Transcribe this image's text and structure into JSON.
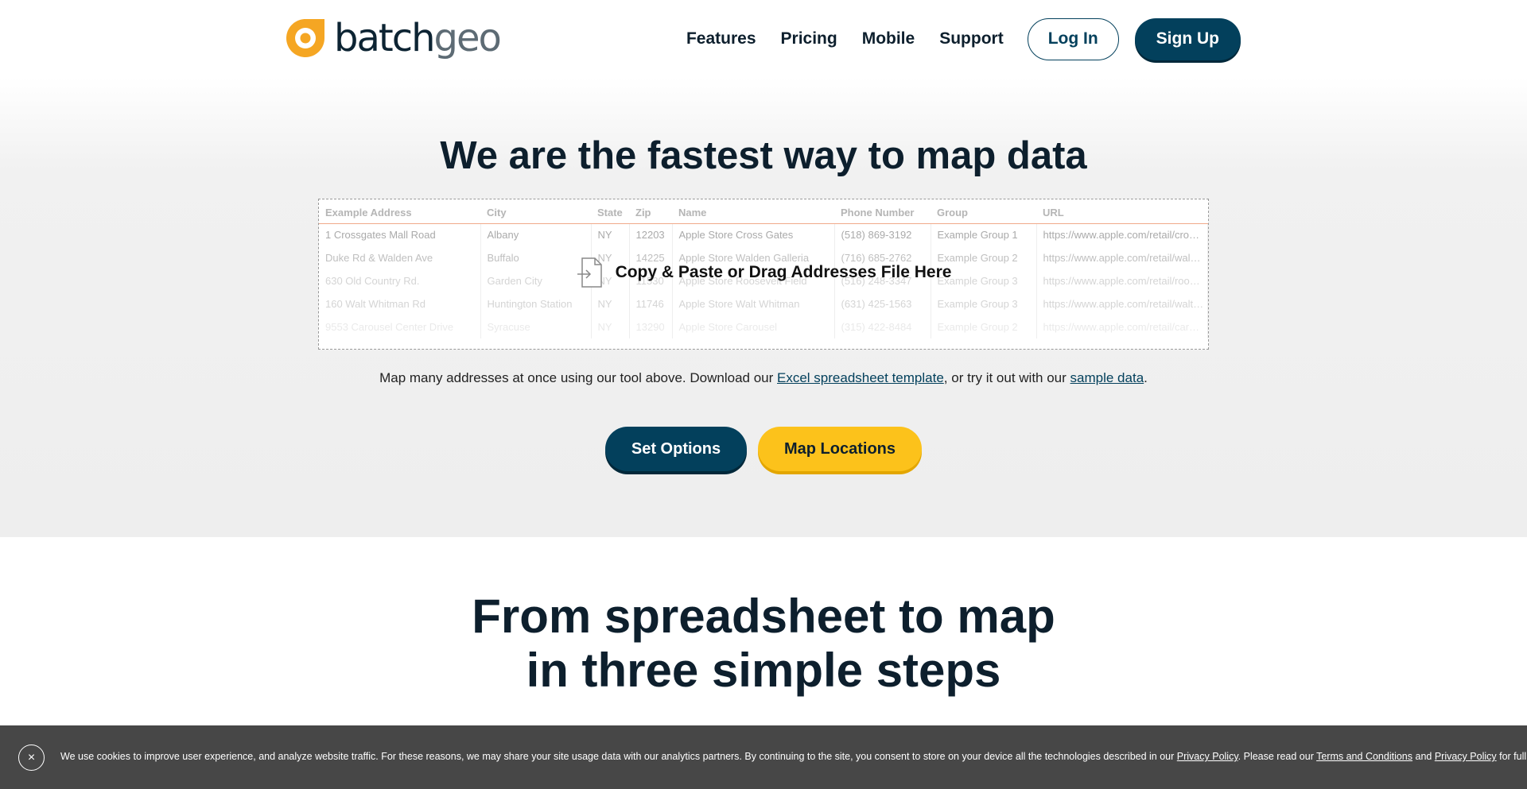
{
  "header": {
    "logo_primary": "batch",
    "logo_secondary": "geo",
    "nav": [
      "Features",
      "Pricing",
      "Mobile",
      "Support"
    ],
    "login_label": "Log In",
    "signup_label": "Sign Up"
  },
  "hero": {
    "title": "We are the fastest way to map data",
    "dropzone_label": "Copy & Paste or Drag Addresses File Here",
    "columns": [
      "Example Address",
      "City",
      "State",
      "Zip",
      "Name",
      "Phone Number",
      "Group",
      "URL"
    ],
    "rows": [
      [
        "1 Crossgates Mall Road",
        "Albany",
        "NY",
        "12203",
        "Apple Store Cross Gates",
        "(518) 869-3192",
        "Example Group 1",
        "https://www.apple.com/retail/crossgates"
      ],
      [
        "Duke Rd & Walden Ave",
        "Buffalo",
        "NY",
        "14225",
        "Apple Store Walden Galleria",
        "(716) 685-2762",
        "Example Group 2",
        "https://www.apple.com/retail/waldengalleria"
      ],
      [
        "630 Old Country Rd.",
        "Garden City",
        "NY",
        "11530",
        "Apple Store Roosevelt Field",
        "(516) 248-3347",
        "Example Group 3",
        "https://www.apple.com/retail/rooseveltfield"
      ],
      [
        "160 Walt Whitman Rd",
        "Huntington Station",
        "NY",
        "11746",
        "Apple Store Walt Whitman",
        "(631) 425-1563",
        "Example Group 3",
        "https://www.apple.com/retail/waltwhitman"
      ],
      [
        "9553 Carousel Center Drive",
        "Syracuse",
        "NY",
        "13290",
        "Apple Store Carousel",
        "(315) 422-8484",
        "Example Group 2",
        "https://www.apple.com/retail/carousel"
      ]
    ],
    "helper_prefix": "Map many addresses at once using our tool above. Download our ",
    "helper_link1": "Excel spreadsheet template",
    "helper_middle": ", or try it out with our ",
    "helper_link2": "sample data",
    "helper_suffix": ".",
    "set_options_label": "Set Options",
    "map_locations_label": "Map Locations"
  },
  "steps": {
    "title_line1": "From spreadsheet to map",
    "title_line2": "in three simple steps"
  },
  "cookie": {
    "close_label": "×",
    "text1": "We use cookies to improve user experience, and analyze website traffic. For these reasons, we may share your site usage data with our analytics partners. By continuing to the site, you consent to store on your device all the technologies described in our ",
    "link1": "Privacy Policy",
    "text2": ". Please read our ",
    "link2": "Terms and Conditions",
    "text3": " and ",
    "link3": "Privacy Policy",
    "text4": " for full details."
  },
  "colors": {
    "brand_dark": "#03405c",
    "brand_orange": "#f5a623",
    "cta_yellow": "#fcc21b",
    "cookie_bg": "#474747"
  }
}
